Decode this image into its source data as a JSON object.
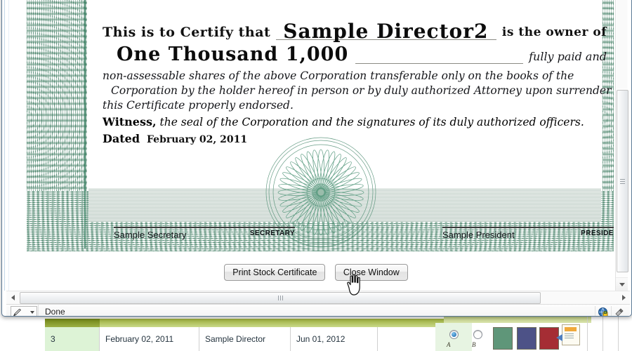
{
  "certificate": {
    "certify_label": "This is to Certify that",
    "holder_name": "Sample Director2",
    "owner_label": "is the owner of",
    "shares_words": "One Thousand  1,000",
    "paid_label": "fully paid and",
    "body_lines": [
      "non-assessable  shares  of  the  above  Corporation  transferable  only  on  the  books  of  the",
      "Corporation by the holder hereof in person or by duly authorized Attorney upon surrender of",
      "this Certificate properly endorsed."
    ],
    "witness_label": "Witness,",
    "witness_text": " the seal of the Corporation and the signatures of its  duly authorized officers.",
    "dated_label": "Dated",
    "dated_value": "February 02, 2011",
    "secretary_name": "Sample Secretary",
    "secretary_role": "SECRETARY",
    "president_name": "Sample President",
    "president_role": "PRESIDENT",
    "rosette_icon": "guilloche-rosette-icon",
    "border_icon": "ornate-guilloche-border-icon",
    "accent_color": "#2f7a5b",
    "band_color": "#d5dfd9"
  },
  "actions": {
    "print_label": "Print Stock Certificate",
    "close_label": "Close Window"
  },
  "scrollbars": {
    "v_up_icon": "scroll-up-icon",
    "v_down_icon": "scroll-down-icon",
    "h_left_icon": "scroll-left-icon",
    "h_right_icon": "scroll-right-icon",
    "grip_icon": "scrollbar-grip-icon"
  },
  "statusbar": {
    "edit_icon": "pencil-edit-icon",
    "edit_dropdown_icon": "chevron-down-icon",
    "status_text": "Done",
    "zone_icon": "internet-zone-icon",
    "zone_secondary_icon": "zone-settings-icon"
  },
  "cursor": {
    "icon": "hand-pointer-cursor"
  },
  "background_app": {
    "row": {
      "number": "3",
      "date": "February 02, 2011",
      "holder": "Sample Director",
      "expires": "Jun 01, 2012"
    },
    "swatches": [
      "#5f9679",
      "#4d5287",
      "#a52d34"
    ],
    "radio_selected_icon": "radio-selected-icon",
    "radio_unselected_icon": "radio-unselected-icon",
    "doc_icon": "document-import-icon",
    "mini_label_a": "A",
    "mini_label_b": "B"
  }
}
